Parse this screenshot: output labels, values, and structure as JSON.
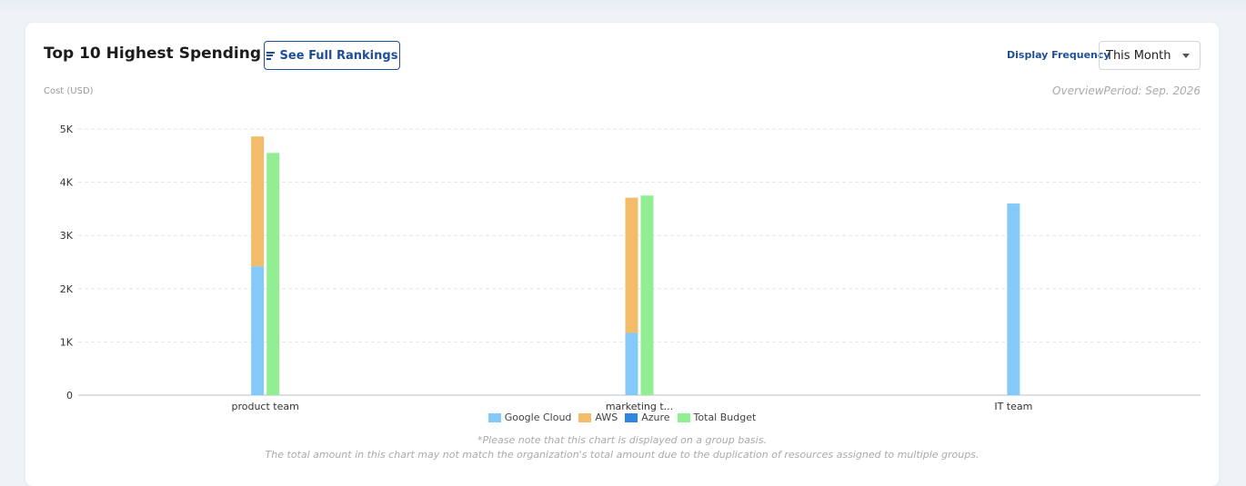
{
  "header": {
    "title": "Top 10 Highest Spending Team",
    "rankings_button": "See Full Rankings",
    "frequency_label": "Display Frequency",
    "frequency_value": "This Month",
    "overview_period": "OverviewPeriod: Sep. 2026",
    "cost_unit": "Cost (USD)"
  },
  "notes": {
    "line1": "*Please note that this chart is displayed on a group basis.",
    "line2": "The total amount in this chart may not match the organization's total amount due to the duplication of resources assigned to multiple groups."
  },
  "colors": {
    "google_cloud": "#85c9f9",
    "aws": "#f2bc6a",
    "azure": "#2f86e0",
    "total_budget": "#92ee92"
  },
  "chart_data": {
    "type": "bar",
    "stacked": true,
    "categories": [
      "product team",
      "marketing t...",
      "IT team"
    ],
    "series": [
      {
        "name": "Google Cloud",
        "stack": "cost",
        "color": "#85c9f9",
        "values": [
          2420,
          1170,
          3600
        ]
      },
      {
        "name": "AWS",
        "stack": "cost",
        "color": "#f2bc6a",
        "values": [
          2440,
          2540,
          0
        ]
      },
      {
        "name": "Azure",
        "stack": "cost",
        "color": "#2f86e0",
        "values": [
          0,
          0,
          0
        ]
      },
      {
        "name": "Total Budget",
        "stack": "budget",
        "color": "#92ee92",
        "values": [
          4550,
          3750,
          0
        ]
      }
    ],
    "ylabel": "Cost (USD)",
    "ylim": [
      0,
      5000
    ],
    "yticks": [
      {
        "value": 0,
        "label": "0"
      },
      {
        "value": 1000,
        "label": "1K"
      },
      {
        "value": 2000,
        "label": "2K"
      },
      {
        "value": 3000,
        "label": "3K"
      },
      {
        "value": 4000,
        "label": "4K"
      },
      {
        "value": 5000,
        "label": "5K"
      }
    ],
    "grid": true,
    "legend_position": "bottom"
  }
}
